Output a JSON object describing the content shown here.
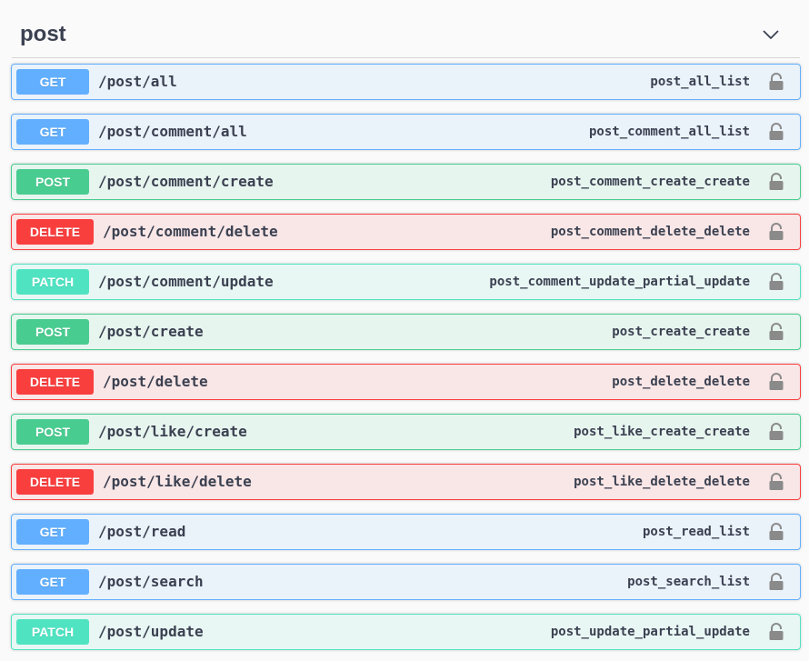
{
  "tag": {
    "title": "post",
    "toggle_icon": "chevron-down-icon"
  },
  "colors": {
    "get": "#61affe",
    "post": "#49cc90",
    "delete": "#f93e3e",
    "patch": "#50e3c2",
    "text": "#3b4151"
  },
  "operations": [
    {
      "method": "GET",
      "path": "/post/all",
      "operation_id": "post_all_list",
      "icon": "lock-icon"
    },
    {
      "method": "GET",
      "path": "/post/comment/all",
      "operation_id": "post_comment_all_list",
      "icon": "lock-icon"
    },
    {
      "method": "POST",
      "path": "/post/comment/create",
      "operation_id": "post_comment_create_create",
      "icon": "lock-icon"
    },
    {
      "method": "DELETE",
      "path": "/post/comment/delete",
      "operation_id": "post_comment_delete_delete",
      "icon": "lock-icon"
    },
    {
      "method": "PATCH",
      "path": "/post/comment/update",
      "operation_id": "post_comment_update_partial_update",
      "icon": "lock-icon"
    },
    {
      "method": "POST",
      "path": "/post/create",
      "operation_id": "post_create_create",
      "icon": "lock-icon"
    },
    {
      "method": "DELETE",
      "path": "/post/delete",
      "operation_id": "post_delete_delete",
      "icon": "lock-icon"
    },
    {
      "method": "POST",
      "path": "/post/like/create",
      "operation_id": "post_like_create_create",
      "icon": "lock-icon"
    },
    {
      "method": "DELETE",
      "path": "/post/like/delete",
      "operation_id": "post_like_delete_delete",
      "icon": "lock-icon"
    },
    {
      "method": "GET",
      "path": "/post/read",
      "operation_id": "post_read_list",
      "icon": "lock-icon"
    },
    {
      "method": "GET",
      "path": "/post/search",
      "operation_id": "post_search_list",
      "icon": "lock-icon"
    },
    {
      "method": "PATCH",
      "path": "/post/update",
      "operation_id": "post_update_partial_update",
      "icon": "lock-icon"
    }
  ]
}
